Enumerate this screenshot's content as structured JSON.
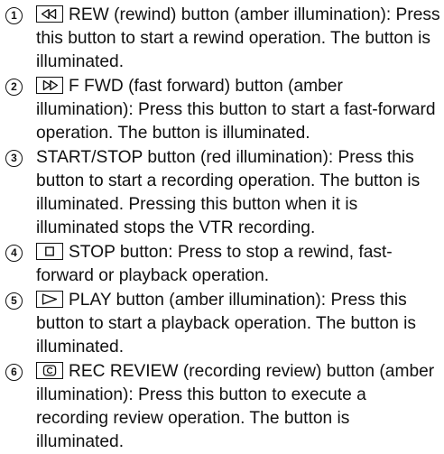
{
  "items": [
    {
      "number": "1",
      "icon": "rewind-icon",
      "text": "REW (rewind) button (amber illumination): Press this button to start a rewind operation. The button is illuminated."
    },
    {
      "number": "2",
      "icon": "fast-forward-icon",
      "text": "F FWD (fast forward) button (amber illumination): Press this button to start a fast-forward operation. The button is illuminated."
    },
    {
      "number": "3",
      "icon": "",
      "text": "START/STOP button (red illumination): Press this button to start a recording operation. The button is illuminated. Pressing this button when it is illuminated stops the VTR recording."
    },
    {
      "number": "4",
      "icon": "stop-icon",
      "text": "STOP button: Press to stop a rewind, fast-forward or playback operation."
    },
    {
      "number": "5",
      "icon": "play-icon",
      "text": "PLAY button (amber illumination): Press this button to start a playback operation. The button is illuminated."
    },
    {
      "number": "6",
      "icon": "rec-review-icon",
      "text": "REC REVIEW (recording review) button (amber illumination): Press this button to execute a recording review operation. The button is illuminated."
    }
  ]
}
